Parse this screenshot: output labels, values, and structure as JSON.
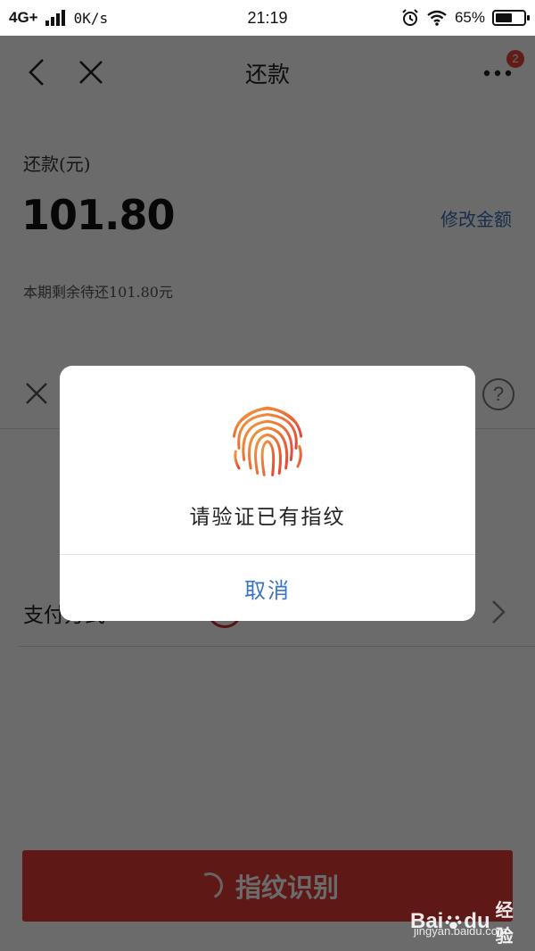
{
  "status_bar": {
    "network": "4G+",
    "speed": "0K/s",
    "time": "21:19",
    "battery_percent": "65%",
    "battery_level": 0.65
  },
  "nav": {
    "title": "还款",
    "badge_count": "2"
  },
  "repayment": {
    "label": "还款(元)",
    "amount": "101.80",
    "edit_label": "修改金额",
    "remaining_note": "本期剩余待还101.80元"
  },
  "payment_sheet": {
    "help_icon_glyph": "?",
    "method_label": "支付方式",
    "confirm_label": "指纹识别"
  },
  "dialog": {
    "message": "请验证已有指纹",
    "cancel_label": "取消"
  },
  "watermark": {
    "logo_text_1": "Bai",
    "logo_text_2": "du",
    "brand_text": "经验",
    "url": "jingyan.baidu.com"
  },
  "colors": {
    "accent_red": "#e03a33",
    "link_blue": "#3b74c4",
    "fingerprint_start": "#f39a3a",
    "fingerprint_end": "#e2473a"
  }
}
